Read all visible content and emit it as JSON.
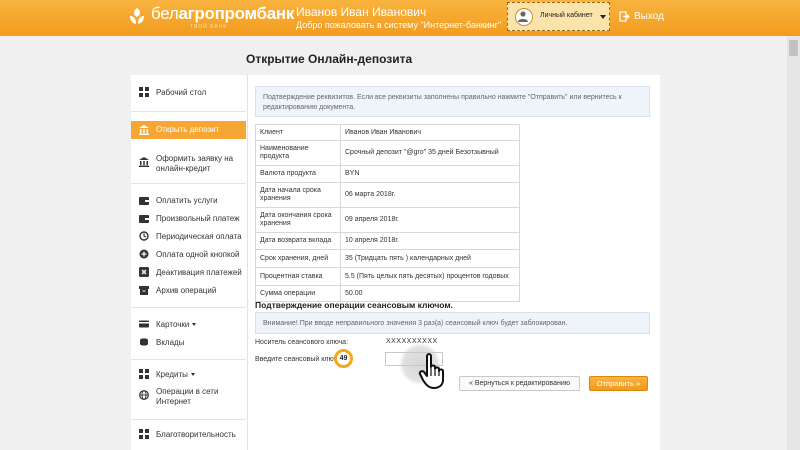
{
  "header": {
    "logo_prefix": "бел",
    "logo_main": "агропромбанк",
    "logo_tagline": "ТВОЙ БАНК",
    "user_name": "Иванов Иван Иванович",
    "welcome": "Добро пожаловать в систему \"Интернет-банкинг\"",
    "cabinet_label": "Личный кабинет",
    "logout_label": "Выход"
  },
  "page_title": "Открытие Онлайн-депозита",
  "sidebar": {
    "items": [
      {
        "label": "Рабочий стол",
        "icon": "grid-icon"
      },
      {
        "label": "Открыть депозит",
        "icon": "bank-icon",
        "active": true
      },
      {
        "label": "Оформить заявку на онлайн-кредит",
        "icon": "bank-icon"
      },
      {
        "label": "Оплатить услуги",
        "icon": "wallet-icon"
      },
      {
        "label": "Произвольный платеж",
        "icon": "wallet-icon"
      },
      {
        "label": "Периодическая оплата",
        "icon": "history-icon"
      },
      {
        "label": "Оплата одной кнопкой",
        "icon": "plus-circle-icon"
      },
      {
        "label": "Деактивация платежей",
        "icon": "close-square-icon"
      },
      {
        "label": "Архив операций",
        "icon": "archive-icon"
      },
      {
        "label": "Карточки",
        "icon": "card-icon"
      },
      {
        "label": "Вклады",
        "icon": "coins-icon"
      },
      {
        "label": "Кредиты",
        "icon": "grid-icon"
      },
      {
        "label": "Операции в сети Интернет",
        "icon": "globe-icon"
      },
      {
        "label": "Благотворительность",
        "icon": "grid-icon"
      }
    ]
  },
  "notice_text": "Подтверждение реквизитов. Если все реквизиты заполнены правильно нажмите \"Отправить\" или вернитесь к редактированию документа.",
  "details": [
    {
      "key": "Клиент",
      "value": "Иванов Иван Иванович"
    },
    {
      "key": "Наименование продукта",
      "value": "Срочный депозит \"@gro\" 35 дней Безотзывный"
    },
    {
      "key": "Валюта продукта",
      "value": "BYN"
    },
    {
      "key": "Дата начала срока хранения",
      "value": "06 марта 2018г."
    },
    {
      "key": "Дата окончания срока хранения",
      "value": "09 апреля 2018г."
    },
    {
      "key": "Дата возврата вклада",
      "value": "10 апреля 2018г."
    },
    {
      "key": "Срок хранения, дней",
      "value": "35 (Тридцать пять ) календарных дней"
    },
    {
      "key": "Процентная ставка",
      "value": "5.5 (Пять целых пять десятых) процентов годовых"
    },
    {
      "key": "Сумма операции",
      "value": "50.00"
    }
  ],
  "session_title": "Подтверждение операции сеансовым ключом.",
  "warning_text": "Внимание! При вводе неправильного значения 3 раз(а) сеансовый ключ будет заблокирован.",
  "carrier_label": "Носитель сеансового ключа:",
  "carrier_value": "XXXXXXXXXX",
  "key_label": "Введите сеансовый ключ N",
  "key_number": "49",
  "key_input_value": "",
  "buttons": {
    "back": "« Вернуться к редактированию",
    "send": "Отправить »"
  },
  "colors": {
    "accent": "#f29c1f",
    "active_item": "#f6a632",
    "notice_bg": "#eef4fa"
  }
}
